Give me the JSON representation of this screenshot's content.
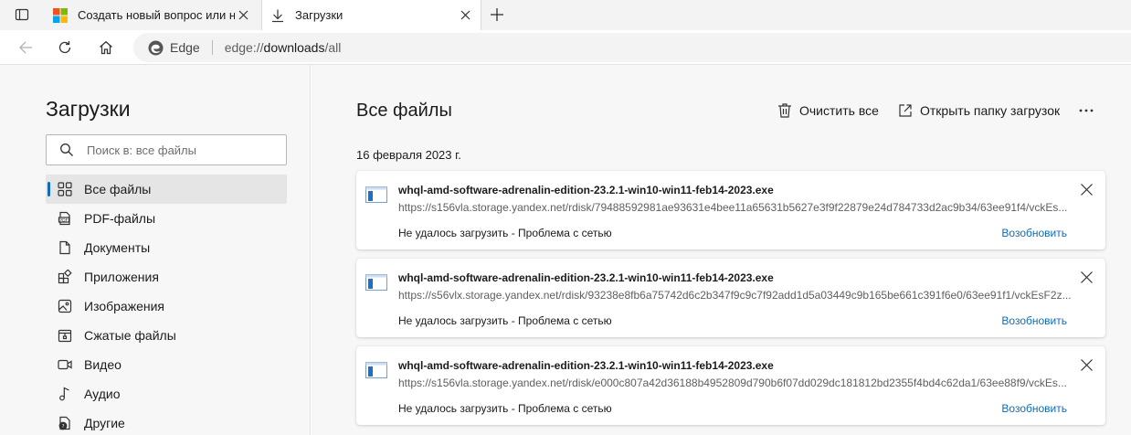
{
  "tabs": [
    {
      "title": "Создать новый вопрос или нач",
      "icon": "microsoft-logo-icon",
      "active": false
    },
    {
      "title": "Загрузки",
      "icon": "download-icon",
      "active": true
    }
  ],
  "omnibox": {
    "label": "Edge",
    "url_scheme": "edge://",
    "url_host": "downloads",
    "url_path": "/all"
  },
  "sidebar": {
    "title": "Загрузки",
    "search_placeholder": "Поиск в: все файлы",
    "items": [
      {
        "label": "Все файлы",
        "icon": "grid-icon",
        "selected": true
      },
      {
        "label": "PDF-файлы",
        "icon": "pdf-icon"
      },
      {
        "label": "Документы",
        "icon": "document-icon"
      },
      {
        "label": "Приложения",
        "icon": "apps-icon"
      },
      {
        "label": "Изображения",
        "icon": "image-icon"
      },
      {
        "label": "Сжатые файлы",
        "icon": "archive-icon"
      },
      {
        "label": "Видео",
        "icon": "video-icon"
      },
      {
        "label": "Аудио",
        "icon": "music-icon"
      },
      {
        "label": "Другие",
        "icon": "other-icon"
      }
    ]
  },
  "main": {
    "title": "Все файлы",
    "clear_all": "Очистить все",
    "open_folder": "Открыть папку загрузок",
    "date": "16 февраля 2023 г.",
    "downloads": [
      {
        "name": "whql-amd-software-adrenalin-edition-23.2.1-win10-win11-feb14-2023.exe",
        "url": "https://s156vla.storage.yandex.net/rdisk/79488592981ae93631e4bee11a65631b5627e3f9f22879e24d784733d2ac9b34/63ee91f4/vckEs...",
        "status": "Не удалось загрузить - Проблема с сетью",
        "retry": "Возобновить"
      },
      {
        "name": "whql-amd-software-adrenalin-edition-23.2.1-win10-win11-feb14-2023.exe",
        "url": "https://s56vlx.storage.yandex.net/rdisk/93238e8fb6a75742d6c2b347f9c9c7f92add1d5a03449c9b165be661c391f6e0/63ee91f1/vckEsF2z...",
        "status": "Не удалось загрузить - Проблема с сетью",
        "retry": "Возобновить"
      },
      {
        "name": "whql-amd-software-adrenalin-edition-23.2.1-win10-win11-feb14-2023.exe",
        "url": "https://s156vla.storage.yandex.net/rdisk/e000c807a42d36188b4952809d790b6f07dd029dc181812bd2355f4bd4c62da1/63ee88f9/vckEs...",
        "status": "Не удалось загрузить - Проблема с сетью",
        "retry": "Возобновить"
      }
    ]
  }
}
